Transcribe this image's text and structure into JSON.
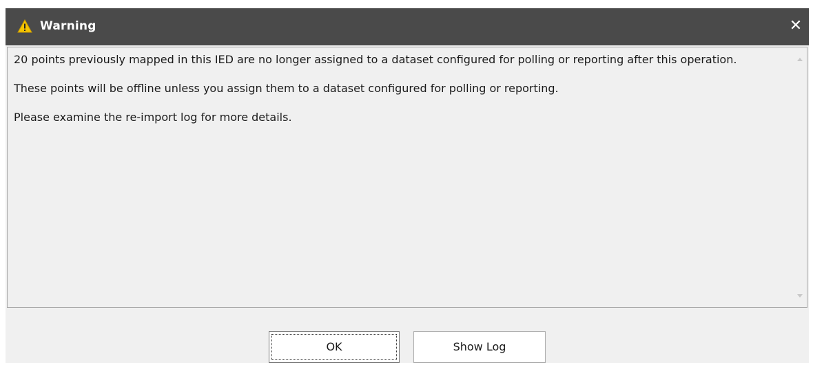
{
  "dialog": {
    "title": "Warning",
    "icon": "warning-icon",
    "close_glyph": "✕"
  },
  "message": {
    "paragraphs": [
      "20 points previously mapped in this IED are no longer assigned to a dataset configured for polling or reporting after this operation.",
      "These points will be offline unless you assign them to a dataset configured for polling or reporting.",
      "Please examine the re-import log for more details."
    ]
  },
  "buttons": {
    "ok_label": "OK",
    "show_log_label": "Show Log"
  },
  "colors": {
    "titlebar": "#4a4a4a",
    "warning_icon": "#f5c400",
    "dialog_background": "#f0f0f0"
  }
}
